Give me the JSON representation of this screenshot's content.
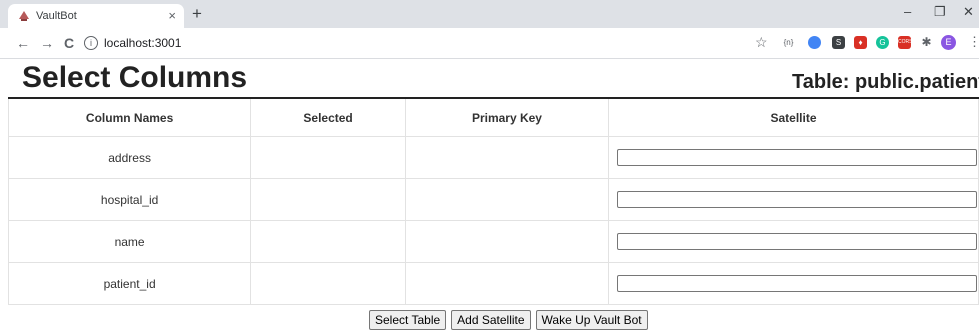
{
  "browser": {
    "tab_title": "VaultBot",
    "tab_close": "×",
    "new_tab": "+",
    "url": "localhost:3001",
    "window_controls": {
      "minimize": "–",
      "restore": "❐",
      "close": "✕"
    },
    "nav": {
      "back": "←",
      "forward": "→",
      "reload": "C",
      "info": "i"
    },
    "extensions": [
      {
        "label": "S",
        "color": "#3c4043"
      },
      {
        "label": "♦",
        "color": "#d93025"
      },
      {
        "label": "G",
        "color": "#15c39a"
      },
      {
        "label": "CORS",
        "color": "#d93025"
      }
    ],
    "avatar": "E"
  },
  "page": {
    "title": "Select Columns",
    "table_label": "Table: public.patients"
  },
  "columns_table": {
    "headers": [
      "Column Names",
      "Selected",
      "Primary Key",
      "Satellite"
    ],
    "rows": [
      {
        "name": "address",
        "satellite_value": ""
      },
      {
        "name": "hospital_id",
        "satellite_value": ""
      },
      {
        "name": "name",
        "satellite_value": ""
      },
      {
        "name": "patient_id",
        "satellite_value": ""
      }
    ]
  },
  "actions": {
    "select_table": "Select Table",
    "add_satellite": "Add Satellite",
    "wake_up": "Wake Up Vault Bot"
  }
}
